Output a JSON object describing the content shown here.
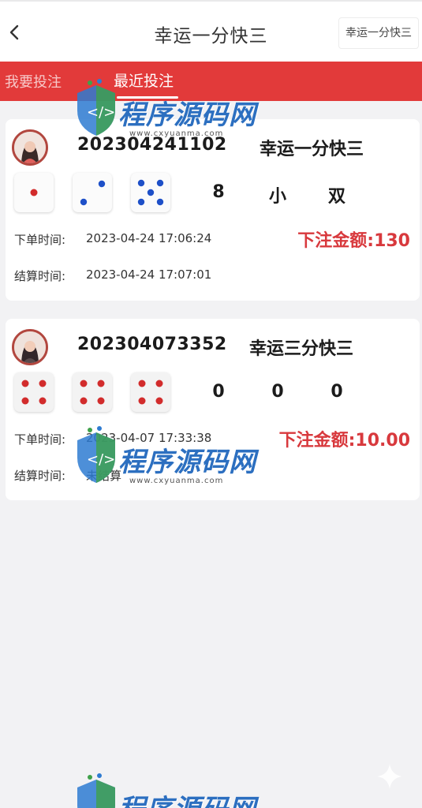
{
  "header": {
    "title": "幸运一分快三",
    "game_switch": "幸运一分快三"
  },
  "tabs": {
    "bet": "我要投注",
    "recent": "最近投注"
  },
  "colors": {
    "brand_red": "#e23a3a",
    "amount_red": "#d8393d",
    "pip_red": "#d22c2c",
    "pip_blue": "#1e50c8"
  },
  "records": [
    {
      "order_no": "202304241102",
      "game": "幸运一分快三",
      "dice": [
        1,
        2,
        5
      ],
      "dice_color": "mixed",
      "results": [
        "8",
        "小",
        "双"
      ],
      "bet_label": "下单时间:",
      "bet_time": "2023-04-24 17:06:24",
      "settle_label": "结算时间:",
      "settle_time": "2023-04-24 17:07:01",
      "amount": "下注金额:130"
    },
    {
      "order_no": "202304073352",
      "game": "幸运三分快三",
      "dice": [
        4,
        4,
        4
      ],
      "dice_color": "red",
      "results": [
        "0",
        "0",
        "0"
      ],
      "bet_label": "下单时间:",
      "bet_time": "2023-04-07 17:33:38",
      "settle_label": "结算时间:",
      "settle_time": "未结算",
      "amount": "下注金额:10.00"
    }
  ],
  "watermark": {
    "text": "程序源码网",
    "url": "www.cxyuanma.com"
  }
}
